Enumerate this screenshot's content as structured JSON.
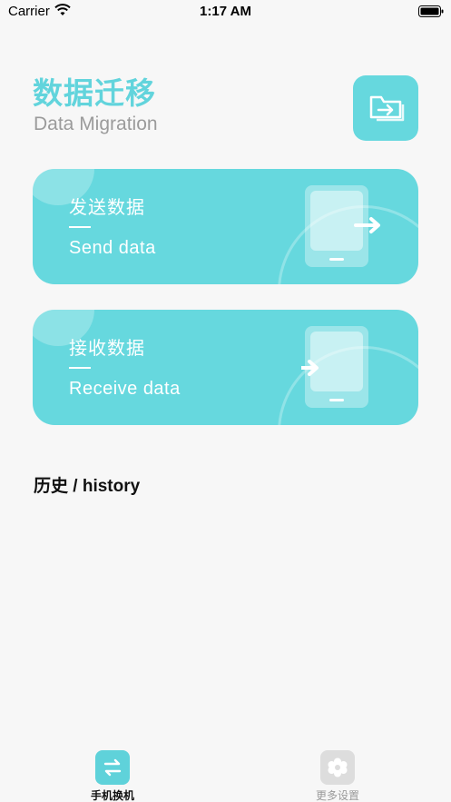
{
  "status_bar": {
    "carrier": "Carrier",
    "time": "1:17 AM"
  },
  "header": {
    "title_cn": "数据迁移",
    "title_en": "Data Migration",
    "folder_icon": "folder-transfer-icon"
  },
  "cards": {
    "send": {
      "title_cn": "发送数据",
      "title_en": "Send data",
      "icon": "phone-send-icon"
    },
    "receive": {
      "title_cn": "接收数据",
      "title_en": "Receive data",
      "icon": "phone-receive-icon"
    }
  },
  "history": {
    "heading": "历史 / history"
  },
  "tab_bar": {
    "items": [
      {
        "label": "手机换机",
        "icon": "swap-icon",
        "selected": true
      },
      {
        "label": "更多设置",
        "icon": "gear-icon",
        "selected": false
      }
    ]
  },
  "colors": {
    "accent": "#66d8de",
    "title": "#62d4dc",
    "muted": "#9b9b9b"
  }
}
